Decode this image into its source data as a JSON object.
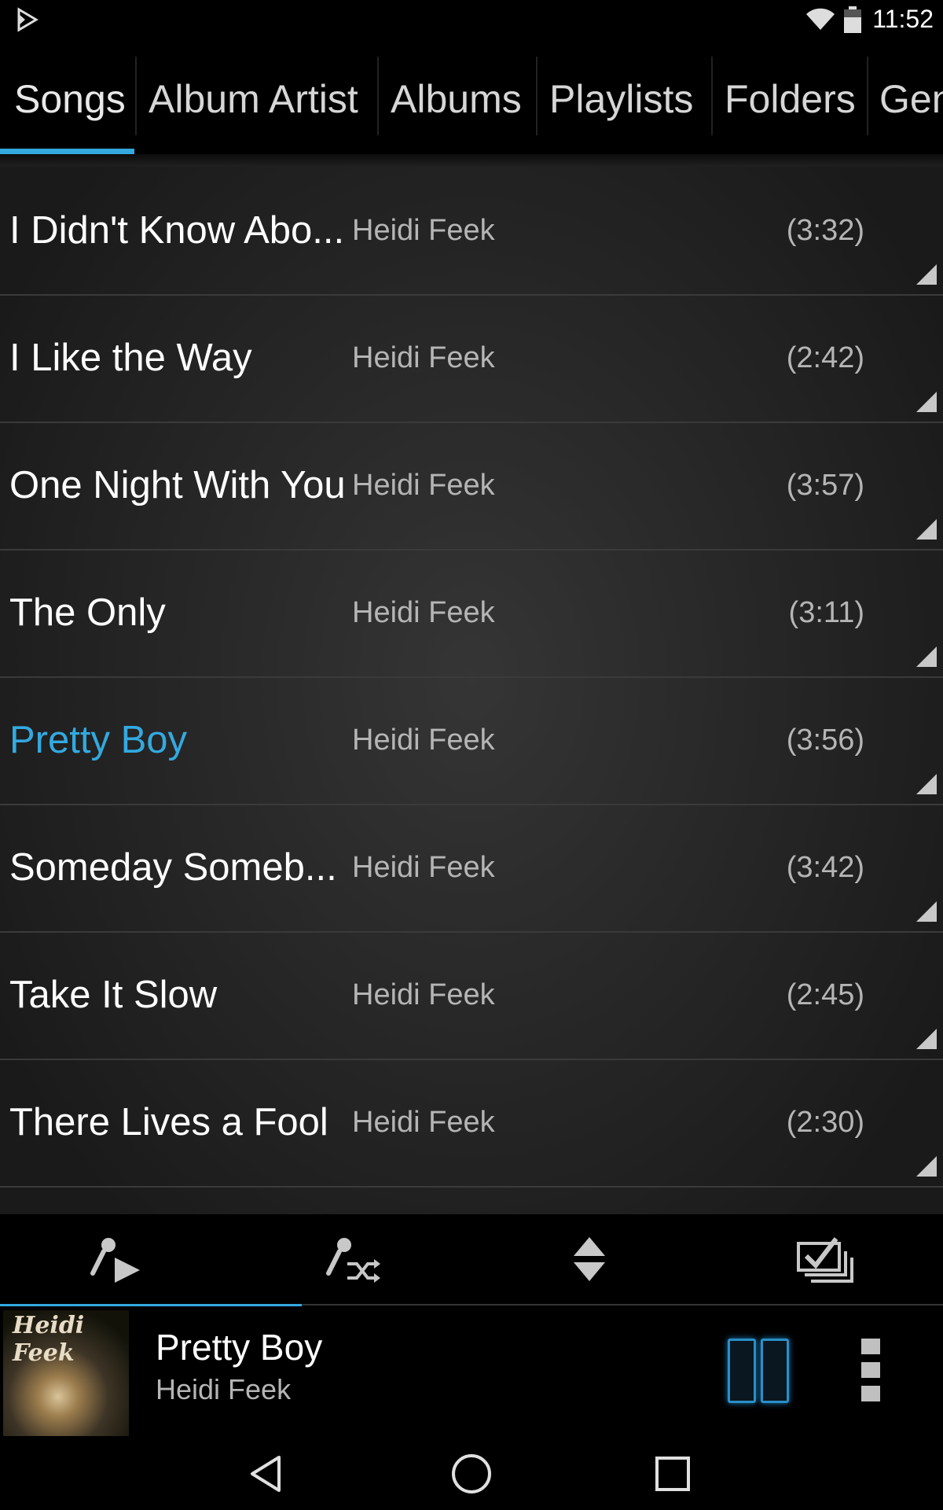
{
  "status_bar": {
    "time": "11:52"
  },
  "tabs": [
    {
      "label": "Songs",
      "active": true
    },
    {
      "label": "Album Artist",
      "active": false
    },
    {
      "label": "Albums",
      "active": false
    },
    {
      "label": "Playlists",
      "active": false
    },
    {
      "label": "Folders",
      "active": false
    },
    {
      "label": "Gen",
      "active": false
    }
  ],
  "songs": [
    {
      "title": "I Didn't Know Abo...",
      "artist": "Heidi Feek",
      "duration": "(3:32)",
      "playing": false
    },
    {
      "title": "I Like the Way",
      "artist": "Heidi Feek",
      "duration": "(2:42)",
      "playing": false
    },
    {
      "title": "One Night With You",
      "artist": "Heidi Feek",
      "duration": "(3:57)",
      "playing": false
    },
    {
      "title": "The Only",
      "artist": "Heidi Feek",
      "duration": "(3:11)",
      "playing": false
    },
    {
      "title": "Pretty Boy",
      "artist": "Heidi Feek",
      "duration": "(3:56)",
      "playing": true
    },
    {
      "title": "Someday Someb...",
      "artist": "Heidi Feek",
      "duration": "(3:42)",
      "playing": false
    },
    {
      "title": "Take It Slow",
      "artist": "Heidi Feek",
      "duration": "(2:45)",
      "playing": false
    },
    {
      "title": "There Lives a Fool",
      "artist": "Heidi Feek",
      "duration": "(2:30)",
      "playing": false
    }
  ],
  "action_bar": {
    "buttons": [
      "play-all-icon",
      "shuffle-all-icon",
      "sort-icon",
      "multi-select-icon"
    ]
  },
  "now_playing": {
    "title": "Pretty Boy",
    "artist": "Heidi Feek",
    "album_art_text": "Heidi Feek",
    "progress": 0.32
  },
  "colors": {
    "accent": "#33a9e0",
    "background": "#000000",
    "list_bg": "#2a2a2a"
  }
}
